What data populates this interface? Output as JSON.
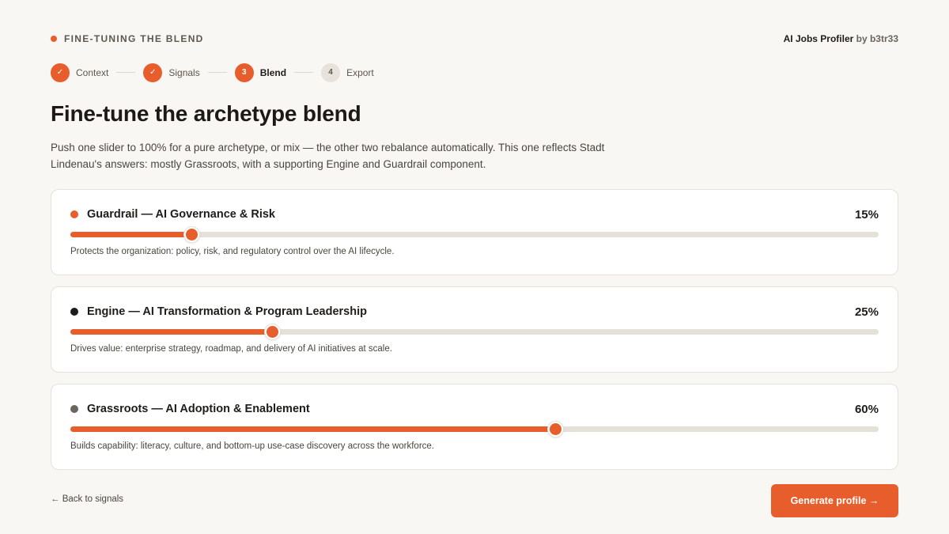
{
  "header": {
    "eyebrow": "FINE-TUNING THE BLEND",
    "app_name": "AI Jobs Profiler",
    "app_by": "by b3tr33"
  },
  "stepper": {
    "steps": [
      {
        "marker": "✓",
        "label": "Context",
        "state": "done"
      },
      {
        "marker": "✓",
        "label": "Signals",
        "state": "done"
      },
      {
        "marker": "3",
        "label": "Blend",
        "state": "current"
      },
      {
        "marker": "4",
        "label": "Export",
        "state": "todo"
      }
    ]
  },
  "main": {
    "title": "Fine-tune the archetype blend",
    "subtitle": "Push one slider to 100% for a pure archetype, or mix — the other two rebalance automatically. This one reflects Stadt Lindenau's answers: mostly Grassroots, with a supporting Engine and Guardrail component."
  },
  "archetypes": [
    {
      "key": "guardrail",
      "title": "Guardrail — AI Governance & Risk",
      "percent_label": "15%",
      "value": 15,
      "dot_color": "#e85d2c",
      "description": "Protects the organization: policy, risk, and regulatory control over the AI lifecycle."
    },
    {
      "key": "engine",
      "title": "Engine — AI Transformation & Program Leadership",
      "percent_label": "25%",
      "value": 25,
      "dot_color": "#1f1c19",
      "description": "Drives value: enterprise strategy, roadmap, and delivery of AI initiatives at scale."
    },
    {
      "key": "grassroots",
      "title": "Grassroots — AI Adoption & Enablement",
      "percent_label": "60%",
      "value": 60,
      "dot_color": "#6b655e",
      "description": "Builds capability: literacy, culture, and bottom-up use-case discovery across the workforce."
    }
  ],
  "footer": {
    "back_label": "← Back to signals",
    "cta_label": "Generate profile →"
  },
  "colors": {
    "accent": "#e85d2c",
    "background": "#f9f7f3",
    "track": "#e6e1d8"
  }
}
